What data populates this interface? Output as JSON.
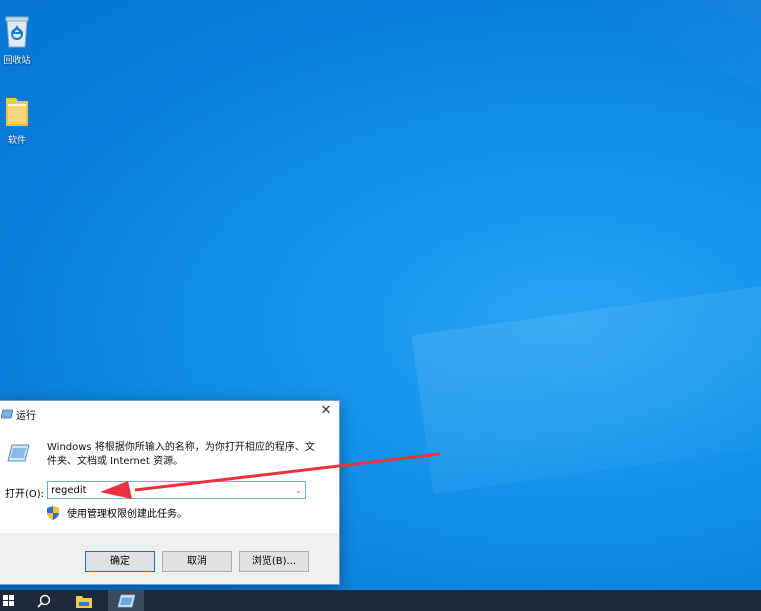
{
  "desktop": {
    "icons": [
      {
        "label": "回收站",
        "icon": "recycle-bin-icon"
      },
      {
        "label": "软件",
        "icon": "folder-icon"
      }
    ]
  },
  "run_dialog": {
    "title": "运行",
    "close_glyph": "✕",
    "description": "Windows 将根据你所输入的名称，为你打开相应的程序、文件夹、文档或 Internet 资源。",
    "open_label": "打开(O):",
    "open_value": "regedit",
    "admin_note": "使用管理权限创建此任务。",
    "buttons": {
      "ok": "确定",
      "cancel": "取消",
      "browse": "浏览(B)..."
    }
  },
  "taskbar": {
    "items": [
      "start-icon",
      "search-icon",
      "file-explorer-icon",
      "run-icon"
    ]
  },
  "colors": {
    "desktop": "#1493ea",
    "taskbar": "#1d2a3a",
    "annotation_arrow": "#e8323c",
    "accent": "#0078d7"
  }
}
